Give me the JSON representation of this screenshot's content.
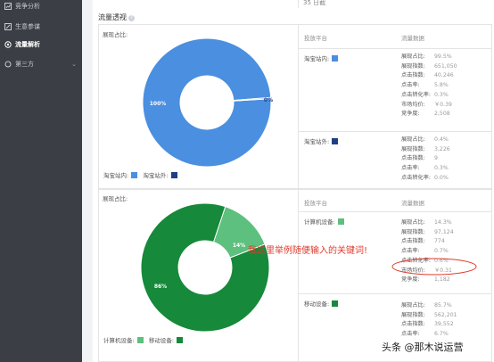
{
  "sidebar": {
    "items": [
      {
        "label": "竞争分析",
        "icon": "chart-icon"
      },
      {
        "label": "生意参谋",
        "icon": "edit-icon"
      },
      {
        "label": "流量解析",
        "icon": "gear-icon"
      },
      {
        "label": "第三方",
        "icon": "circle-icon"
      }
    ],
    "active_index": 2
  },
  "top_row": {
    "value": "35 日截"
  },
  "section": {
    "title": "流量透视",
    "help": "?"
  },
  "upper": {
    "left_label": "展现占比:",
    "header_platform": "投放平台",
    "header_data": "流量数据",
    "legend": [
      {
        "label": "淘宝站内:",
        "color": "#4a8fe0"
      },
      {
        "label": "淘宝站外:",
        "color": "#1e3f87"
      }
    ],
    "rows": [
      {
        "platform": "淘宝站内:",
        "color": "#4a8fe0",
        "metrics": [
          {
            "label": "展现占比:",
            "value": "99.5%"
          },
          {
            "label": "展现指数:",
            "value": "651,050"
          },
          {
            "label": "点击指数:",
            "value": "40,246"
          },
          {
            "label": "点击率:",
            "value": "5.8%"
          },
          {
            "label": "点击转化率:",
            "value": "0.3%"
          },
          {
            "label": "市场均价:",
            "value": "￥0.39"
          },
          {
            "label": "竞争度:",
            "value": "2,508"
          }
        ]
      },
      {
        "platform": "淘宝站外:",
        "color": "#1e3f87",
        "metrics": [
          {
            "label": "展现占比:",
            "value": "0.4%"
          },
          {
            "label": "展现指数:",
            "value": "3,226"
          },
          {
            "label": "点击指数:",
            "value": "9"
          },
          {
            "label": "点击率:",
            "value": "0.3%"
          },
          {
            "label": "点击转化率:",
            "value": "0.0%"
          }
        ]
      }
    ]
  },
  "lower": {
    "left_label": "展现占比:",
    "header_platform": "投放平台",
    "header_data": "流量数据",
    "legend": [
      {
        "label": "计算机设备:",
        "color": "#5dc07e"
      },
      {
        "label": "移动设备:",
        "color": "#16893a"
      }
    ],
    "rows": [
      {
        "platform": "计算机设备:",
        "color": "#5dc07e",
        "metrics": [
          {
            "label": "展现占比:",
            "value": "14.3%"
          },
          {
            "label": "展现指数:",
            "value": "97,124"
          },
          {
            "label": "点击指数:",
            "value": "774"
          },
          {
            "label": "点击率:",
            "value": "0.7%"
          },
          {
            "label": "点击转化率:",
            "value": "0.6%"
          },
          {
            "label": "市场均价:",
            "value": "￥0.31"
          },
          {
            "label": "竞争度:",
            "value": "1,182"
          }
        ]
      },
      {
        "platform": "移动设备:",
        "color": "#16893a",
        "metrics": [
          {
            "label": "展现占比:",
            "value": "85.7%"
          },
          {
            "label": "展现指数:",
            "value": "562,201"
          },
          {
            "label": "点击指数:",
            "value": "39,552"
          },
          {
            "label": "点击率:",
            "value": "6.7%"
          }
        ]
      }
    ]
  },
  "annotation": {
    "text": "我这里举例随便输入的关键词!",
    "color": "#e03a2c"
  },
  "watermark": {
    "text": "头条 @那木说运营"
  },
  "chart_data": [
    {
      "type": "pie",
      "categories": [
        "淘宝站内",
        "淘宝站外"
      ],
      "values": [
        100,
        0
      ],
      "data_labels": [
        "100%",
        "0%"
      ],
      "colors": [
        "#4a8fe0",
        "#1e3f87"
      ]
    },
    {
      "type": "pie",
      "categories": [
        "计算机设备",
        "移动设备"
      ],
      "values": [
        14,
        86
      ],
      "data_labels": [
        "14%",
        "86%"
      ],
      "colors": [
        "#5dc07e",
        "#16893a"
      ]
    }
  ]
}
